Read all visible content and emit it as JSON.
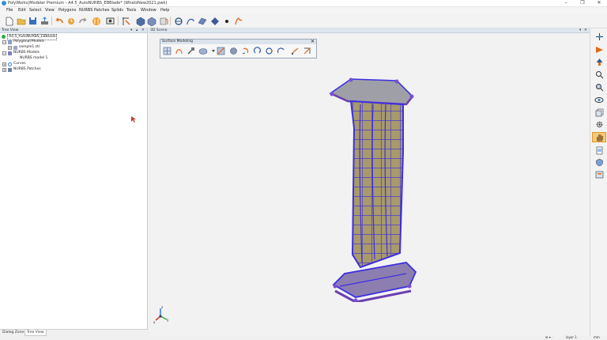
{
  "window": {
    "title": "PolyWorks|Modeler Premium - A4.5_AutoNURBS_EBBlade* (WhatsNew2021.pwk)",
    "controls": [
      "–",
      "❐",
      "✕"
    ]
  },
  "menu": [
    "File",
    "Edit",
    "Select",
    "View",
    "Polygons",
    "NURBS Patches",
    "Splids",
    "Tools",
    "Window",
    "Help"
  ],
  "tree_view": {
    "header": "Tree View",
    "header_controls": [
      "▾",
      "▴",
      "✕"
    ],
    "root": "A4.5_AutoNURBS_EBBlade",
    "nodes": [
      {
        "label": "Polygonal Models",
        "expander": "−"
      },
      {
        "label": "sample1.stl",
        "expander": "+"
      },
      {
        "label": "NURBS Models",
        "expander": "−"
      },
      {
        "label": "NURBS model 1",
        "expander": ""
      },
      {
        "label": "Curves",
        "expander": "+"
      },
      {
        "label": "NURBS Patches",
        "expander": "+"
      }
    ]
  },
  "bottom_tabs": [
    "Dialog Zone",
    "Tree View"
  ],
  "scene": {
    "header": "3D Scene",
    "header_controls": [
      "▾",
      "✕"
    ],
    "axes": {
      "x": "x",
      "y": "y",
      "z": "z"
    }
  },
  "surface_modeling": {
    "title": "Surface Modeling",
    "close": "✕"
  },
  "status": {
    "left": "⊞ ▾ ·",
    "layer": "layer 1",
    "units": "mm"
  },
  "colors": {
    "accent": "#2f7fd6",
    "mesh": "#3d2fe0",
    "surface": "#a89a6a",
    "highlight": "#f0b040"
  }
}
